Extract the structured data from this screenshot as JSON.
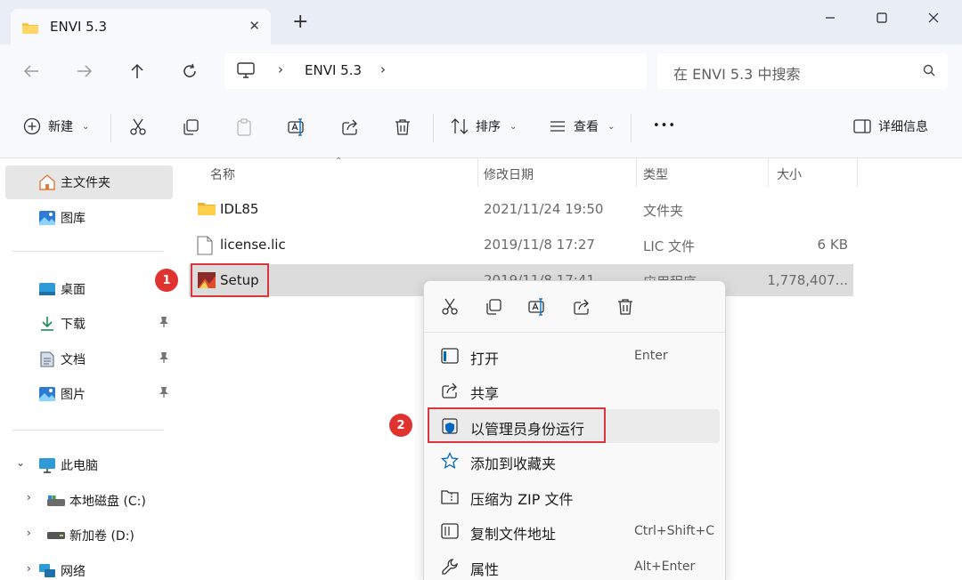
{
  "window": {
    "tab_title": "ENVI 5.3",
    "tab_close": "✕",
    "new_tab": "+"
  },
  "address": {
    "crumb_sep": "›",
    "folder": "ENVI 5.3"
  },
  "search": {
    "placeholder": "在 ENVI 5.3 中搜索"
  },
  "toolbar": {
    "new_label": "新建",
    "sort_label": "排序",
    "view_label": "查看",
    "more": "•••",
    "details_label": "详细信息",
    "dropdown": "⌄"
  },
  "sidebar": {
    "items": [
      {
        "label": "主文件夹",
        "icon": "home-icon"
      },
      {
        "label": "图库",
        "icon": "gallery-icon"
      },
      {
        "label": "桌面",
        "icon": "desktop-icon"
      },
      {
        "label": "下载",
        "icon": "download-icon"
      },
      {
        "label": "文档",
        "icon": "document-icon"
      },
      {
        "label": "图片",
        "icon": "pictures-icon"
      },
      {
        "label": "此电脑",
        "icon": "computer-icon"
      },
      {
        "label": "本地磁盘 (C:)",
        "icon": "drive-icon"
      },
      {
        "label": "新加卷 (D:)",
        "icon": "drive-icon"
      },
      {
        "label": "网络",
        "icon": "network-icon"
      }
    ],
    "expanded_chevron": "⌄",
    "collapsed_chevron": "›"
  },
  "list": {
    "columns": [
      "名称",
      "修改日期",
      "类型",
      "大小"
    ],
    "sort_indicator": "⌃",
    "rows": [
      {
        "name": "IDL85",
        "date": "2021/11/24 19:50",
        "type": "文件夹",
        "size": ""
      },
      {
        "name": "license.lic",
        "date": "2019/11/8 17:27",
        "type": "LIC 文件",
        "size": "6 KB"
      },
      {
        "name": "Setup",
        "date": "2019/11/8 17:41",
        "type": "应用程序",
        "size": "1,778,407..."
      }
    ]
  },
  "markers": [
    "1",
    "2"
  ],
  "context_menu": {
    "items": [
      {
        "label": "打开",
        "shortcut": "Enter",
        "icon": "open-icon"
      },
      {
        "label": "共享",
        "shortcut": "",
        "icon": "share-icon"
      },
      {
        "label": "以管理员身份运行",
        "shortcut": "",
        "icon": "shield-icon"
      },
      {
        "label": "添加到收藏夹",
        "shortcut": "",
        "icon": "star-icon"
      },
      {
        "label": "压缩为 ZIP 文件",
        "shortcut": "",
        "icon": "zip-icon"
      },
      {
        "label": "复制文件地址",
        "shortcut": "Ctrl+Shift+C",
        "icon": "copy-path-icon"
      },
      {
        "label": "属性",
        "shortcut": "Alt+Enter",
        "icon": "wrench-icon"
      }
    ]
  },
  "colors": {
    "accent": "#0067c0",
    "highlight_red": "#d9363e",
    "folder_yellow": "#f3c343"
  }
}
